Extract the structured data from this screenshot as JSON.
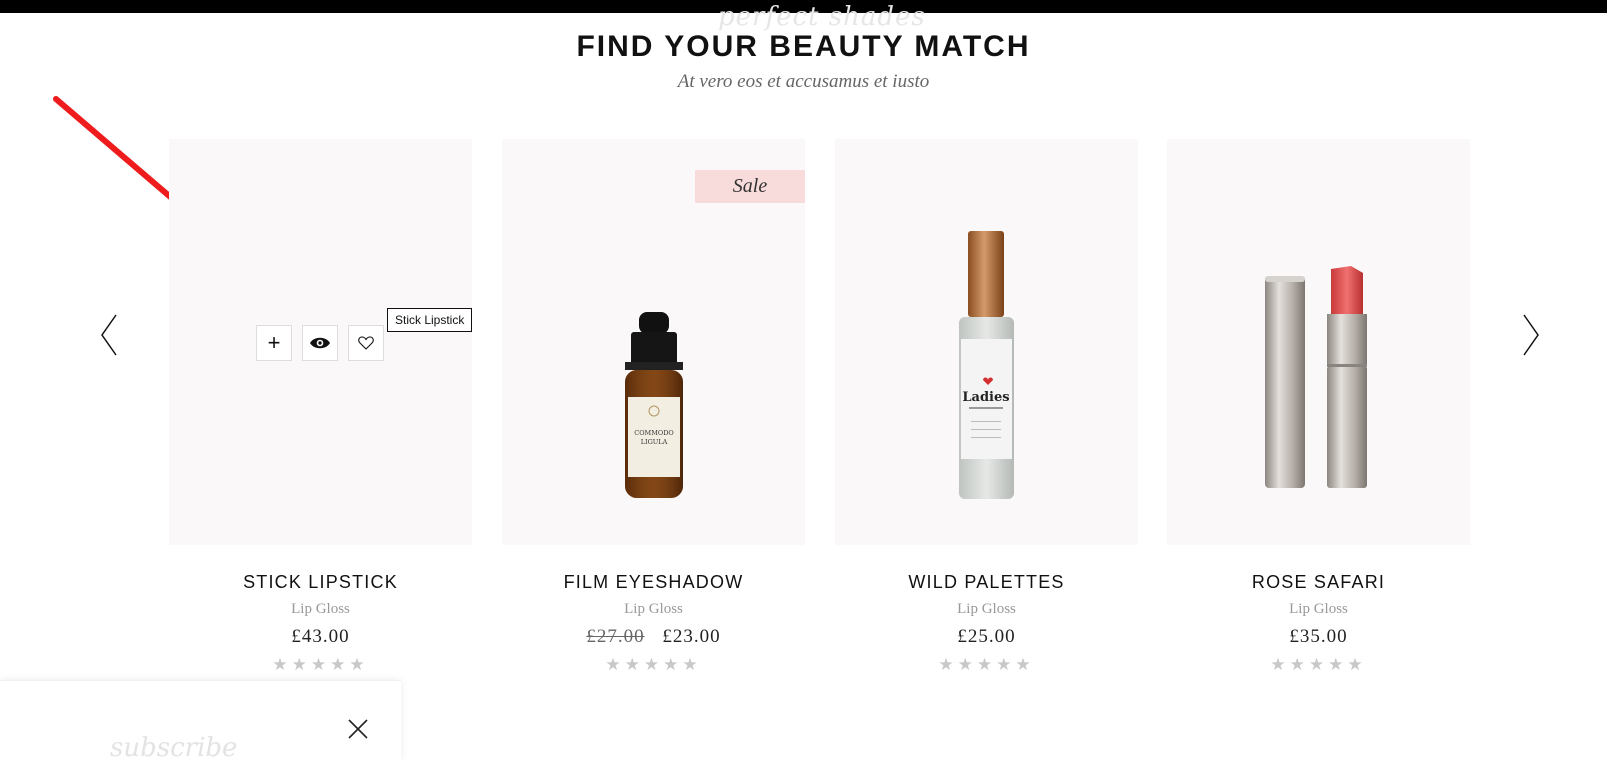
{
  "header": {
    "decor_script": "perfect shades",
    "title": "FIND YOUR BEAUTY MATCH",
    "subtitle": "At vero eos et accusamus et iusto"
  },
  "carousel": {
    "prev_icon": "chevron-left-icon",
    "next_icon": "chevron-right-icon"
  },
  "products": [
    {
      "name": "STICK LIPSTICK",
      "category": "Lip Gloss",
      "price": "£43.00",
      "old_price": "",
      "rating_stars": "★★★★★",
      "rating": 0,
      "tooltip": "Stick Lipstick",
      "actions": {
        "add_label": "+",
        "add_icon": "plus-icon",
        "view_icon": "eye-icon",
        "wishlist_icon": "heart-icon"
      }
    },
    {
      "name": "FILM EYESHADOW",
      "category": "Lip Gloss",
      "price": "£23.00",
      "old_price": "£27.00",
      "rating_stars": "★★★★★",
      "rating": 0,
      "badge": "Sale",
      "image_label_1": "COMMODO",
      "image_label_2": "LIGULA"
    },
    {
      "name": "WILD PALETTES",
      "category": "Lip Gloss",
      "price": "£25.00",
      "old_price": "",
      "rating_stars": "★★★★★",
      "rating": 0,
      "image_label": "Ladies"
    },
    {
      "name": "ROSE SAFARI",
      "category": "Lip Gloss",
      "price": "£35.00",
      "old_price": "",
      "rating_stars": "★★★★★",
      "rating": 0
    }
  ],
  "popup": {
    "decor_script": "subscribe",
    "close_icon": "close-icon"
  },
  "annotation": {
    "icon": "arrow-annotation-icon",
    "color": "#ee1c1c"
  },
  "colors": {
    "card_bg": "#faf8f8",
    "sale_badge": "#f8dcdc",
    "star": "#c8c8c8"
  }
}
